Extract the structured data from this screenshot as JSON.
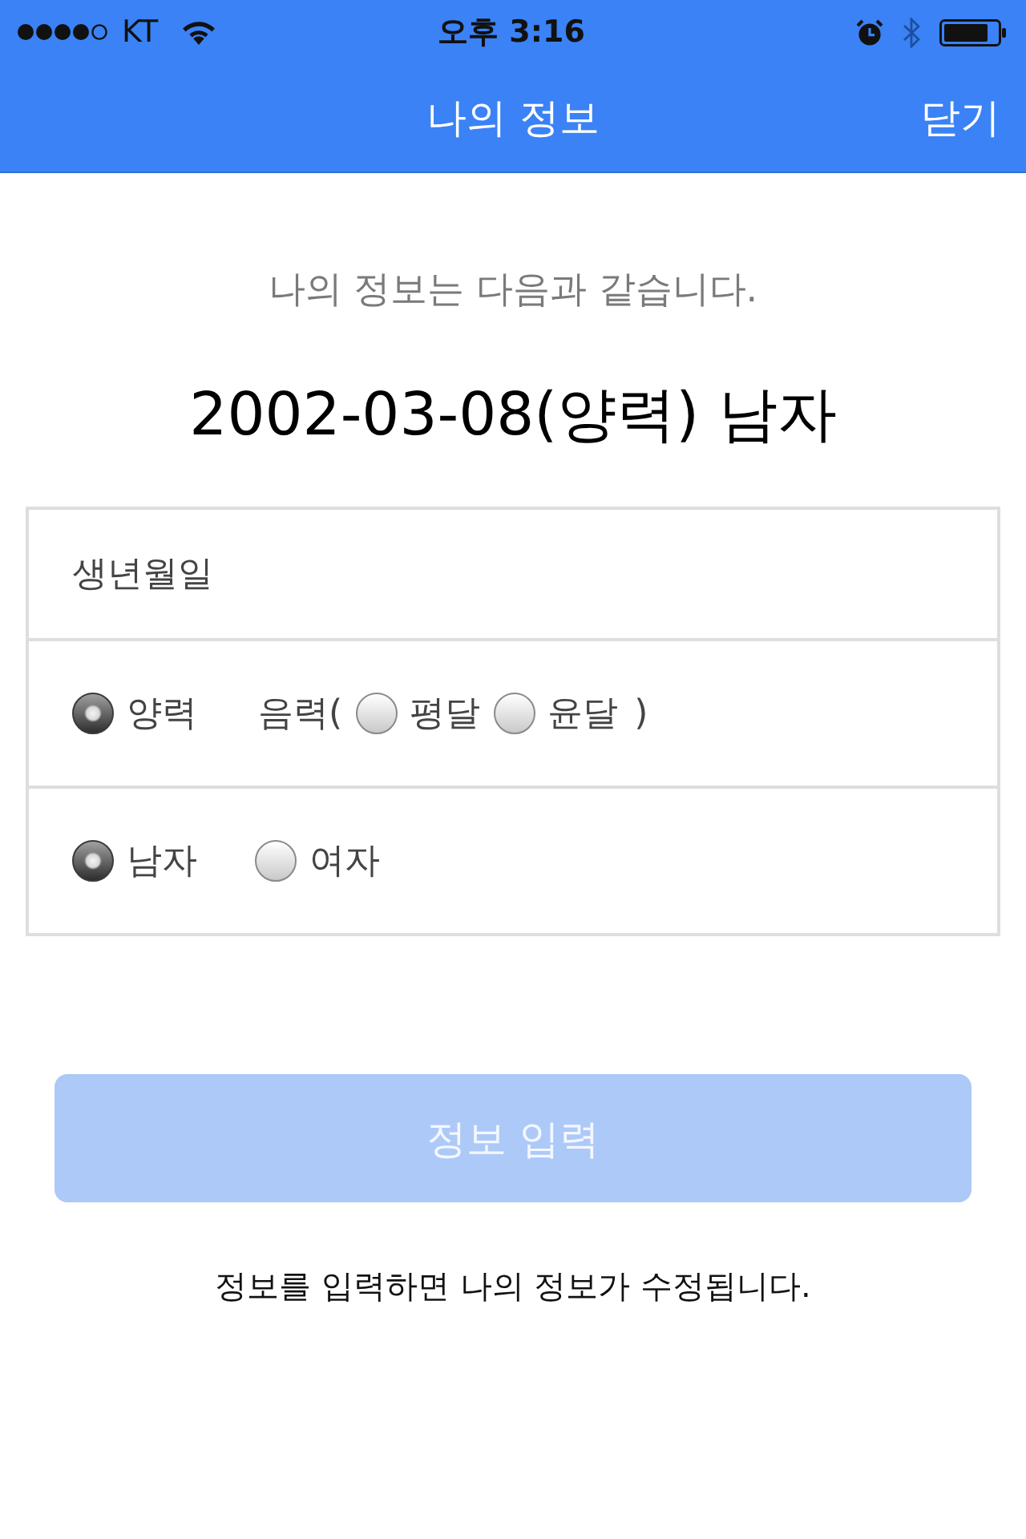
{
  "status_bar": {
    "carrier": "KT",
    "time": "오후 3:16"
  },
  "nav_bar": {
    "title": "나의 정보",
    "close_button": "닫기"
  },
  "intro": "나의 정보는 다음과 같습니다.",
  "summary": "2002-03-08(양력) 남자",
  "form": {
    "birth_label": "생년월일",
    "calendar_row": {
      "solar_option": {
        "label": "양력",
        "selected": true
      },
      "lunar_prefix": "음력(",
      "lunar_options": [
        {
          "label": "평달",
          "selected": false
        },
        {
          "label": "윤달",
          "selected": false
        }
      ],
      "lunar_suffix": ")"
    },
    "gender_options": [
      {
        "label": "남자",
        "selected": true
      },
      {
        "label": "여자",
        "selected": false
      }
    ]
  },
  "submit_button": {
    "label": "정보 입력",
    "disabled": true
  },
  "note": "정보를 입력하면 나의 정보가 수정됩니다."
}
